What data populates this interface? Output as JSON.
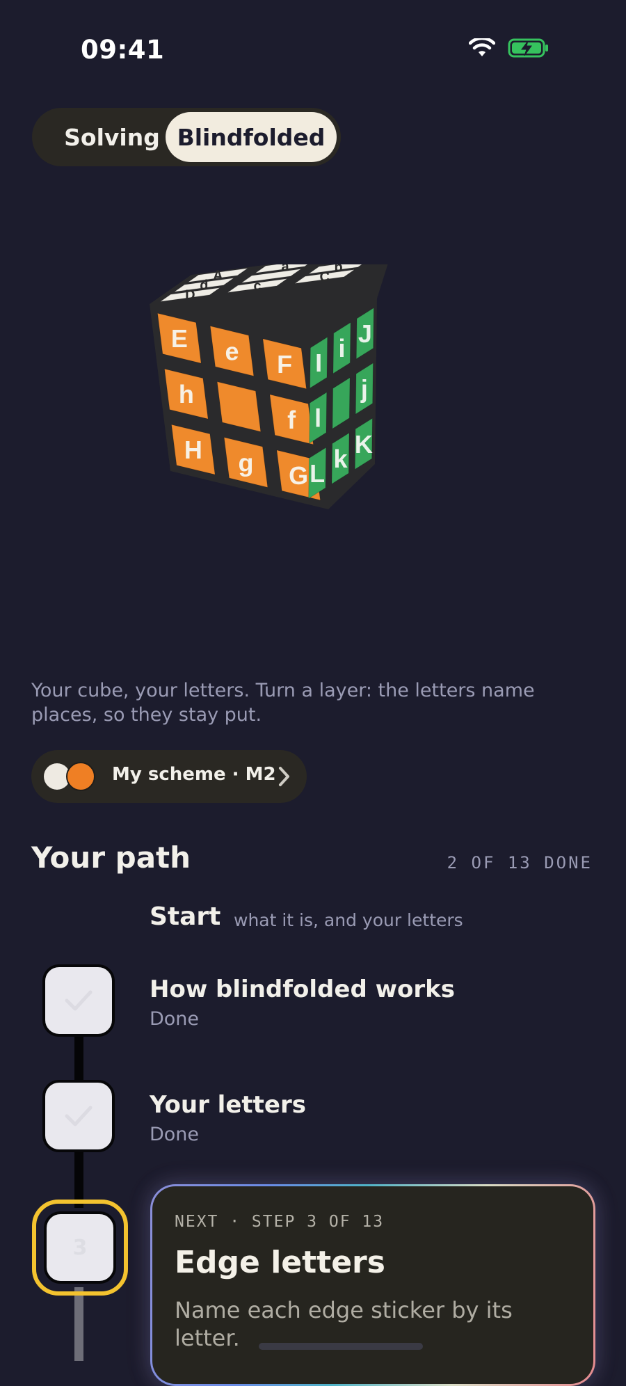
{
  "status_bar": {
    "time": "09:41"
  },
  "mode_toggle": {
    "solving_label": "Solving",
    "blindfolded_label": "Blindfolded",
    "selected": "Blindfolded"
  },
  "cube": {
    "top": [
      [
        "A",
        "a",
        "B"
      ],
      [
        "d",
        "",
        "b"
      ],
      [
        "D",
        "c",
        "C"
      ]
    ],
    "front": [
      [
        "E",
        "e",
        "F"
      ],
      [
        "h",
        "",
        "f"
      ],
      [
        "H",
        "g",
        "G"
      ]
    ],
    "right": [
      [
        "I",
        "i",
        "J"
      ],
      [
        "l",
        "",
        "j"
      ],
      [
        "L",
        "k",
        "K"
      ]
    ],
    "colors": {
      "top": "#efede6",
      "front": "#ef8a2c",
      "right": "#37a65a"
    }
  },
  "intro_text": "Your cube, your letters. Turn a layer: the letters name places, so they stay put.",
  "scheme": {
    "label": "My scheme · M2"
  },
  "path": {
    "title": "Your path",
    "progress": "2 OF 13 DONE",
    "start_title": "Start",
    "start_subtitle": "what it is, and your letters",
    "steps": [
      {
        "title": "How blindfolded works",
        "status": "Done"
      },
      {
        "title": "Your letters",
        "status": "Done"
      },
      {
        "number": "3",
        "eyebrow": "NEXT · STEP 3 OF 13",
        "title": "Edge letters",
        "description": "Name each edge sticker by its letter."
      }
    ]
  },
  "colors": {
    "background": "#1c1c2d",
    "accent_ring": "#f4c32f",
    "done_box": "#e9e8ee"
  }
}
